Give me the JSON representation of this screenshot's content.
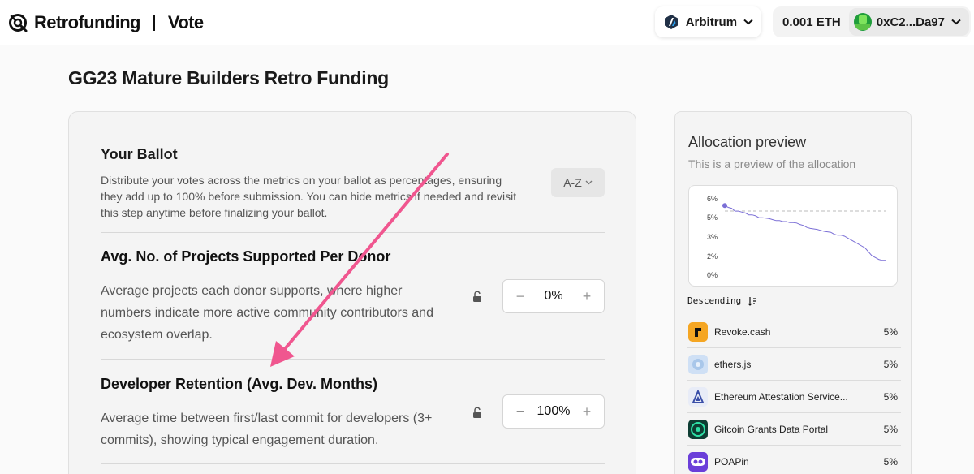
{
  "header": {
    "brand": "Retrofunding",
    "section": "Vote",
    "network": "Arbitrum",
    "balance": "0.001 ETH",
    "address": "0xC2...Da97"
  },
  "page": {
    "title": "GG23 Mature Builders Retro Funding"
  },
  "ballot": {
    "title": "Your Ballot",
    "description": "Distribute your votes across the metrics on your ballot as percentages, ensuring they add up to 100% before submission. You can hide metrics if needed and revisit this step anytime before finalizing your ballot.",
    "sort_label": "A-Z",
    "metrics": [
      {
        "title": "Avg. No. of Projects Supported Per Donor",
        "description": "Average projects each donor supports, where higher numbers indicate more active community contributors and ecosystem overlap.",
        "value": "0%"
      },
      {
        "title": "Developer Retention (Avg. Dev. Months)",
        "description": "Average time between first/last commit for developers (3+ commits), showing typical engagement duration.",
        "value": "100%"
      }
    ]
  },
  "allocation": {
    "title": "Allocation preview",
    "subtitle": "This is a preview of the allocation",
    "sort_label": "Descending",
    "projects": [
      {
        "name": "Revoke.cash",
        "pct": "5%",
        "icon": "revoke-logo",
        "color": "#f5a623"
      },
      {
        "name": "ethers.js",
        "pct": "5%",
        "icon": "ethers-logo",
        "color": "#cfe0f5"
      },
      {
        "name": "Ethereum Attestation Service...",
        "pct": "5%",
        "icon": "eas-logo",
        "color": "#e8ecf7"
      },
      {
        "name": "Gitcoin Grants Data Portal",
        "pct": "5%",
        "icon": "gitcoin-data-logo",
        "color": "#0e3d33"
      },
      {
        "name": "POAPin",
        "pct": "5%",
        "icon": "poapin-logo",
        "color": "#6b3fd9"
      }
    ]
  },
  "chart_data": {
    "type": "line",
    "title": "",
    "xlabel": "",
    "ylabel": "",
    "y_tick_labels": [
      "6%",
      "5%",
      "3%",
      "2%",
      "0%"
    ],
    "y_ticks": [
      6,
      5,
      3,
      2,
      0
    ],
    "ylim": [
      0,
      6
    ],
    "reference_line": 5.0,
    "grid": false,
    "legend": "none",
    "color": "#7b6fd6",
    "series": [
      {
        "values": [
          5.6,
          5.5,
          5.45,
          5.3,
          5.3,
          5.25,
          5.2,
          5.1,
          5.1,
          5.05,
          4.9,
          4.9,
          4.85,
          4.8,
          4.7,
          4.6,
          4.6,
          4.5,
          4.5,
          4.4,
          4.4,
          4.35,
          4.2,
          4.1,
          3.9,
          3.8,
          3.75,
          3.7,
          3.6,
          3.5,
          3.45,
          3.4,
          3.2,
          3.1,
          3.1,
          3.0,
          2.9,
          2.8,
          2.7,
          2.6,
          2.5,
          2.4,
          2.2,
          2.0,
          1.8,
          1.6,
          1.5,
          1.5
        ]
      }
    ]
  }
}
